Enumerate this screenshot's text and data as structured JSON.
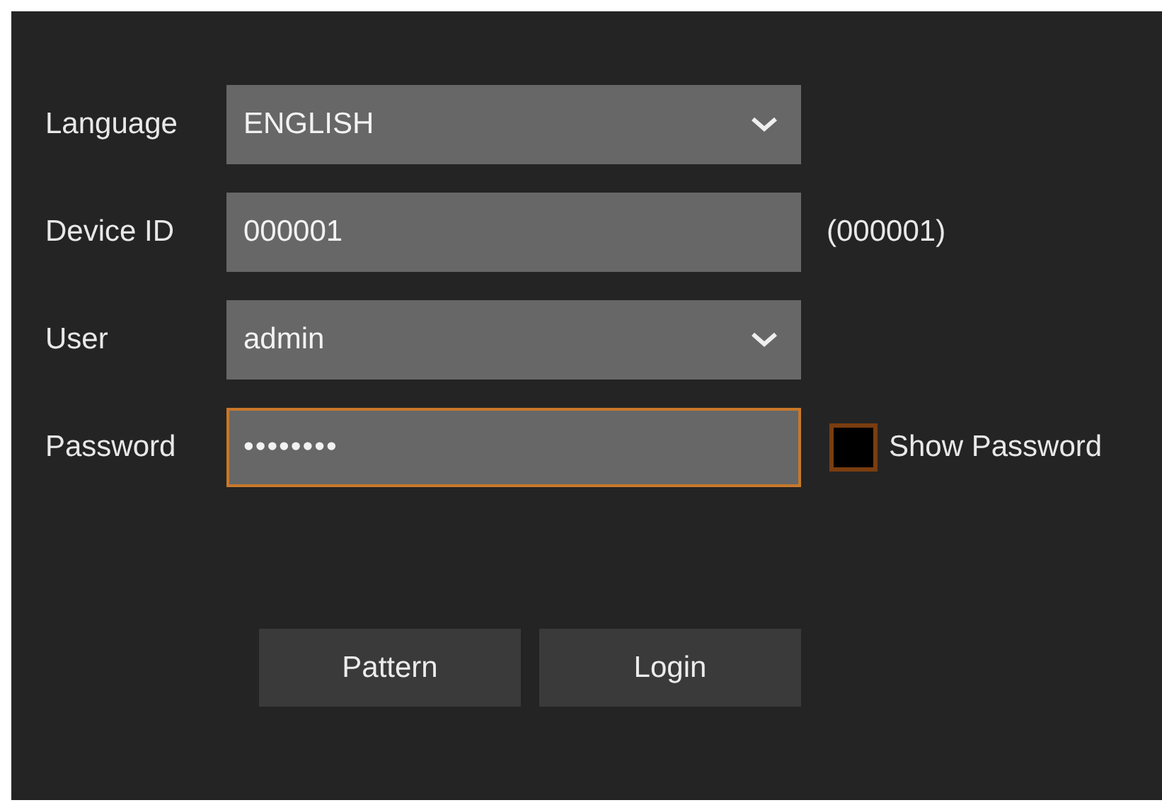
{
  "fields": [
    {
      "label": "Language",
      "kind": "select",
      "value": "ENGLISH",
      "focused": false
    },
    {
      "label": "Device ID",
      "kind": "text",
      "value": "000001",
      "focused": false,
      "note": "(000001)"
    },
    {
      "label": "User",
      "kind": "select",
      "value": "admin",
      "focused": false
    },
    {
      "label": "Password",
      "kind": "password",
      "value": "••••••••",
      "focused": true,
      "show_password": {
        "label": "Show Password",
        "checked": false
      }
    }
  ],
  "buttons": [
    "Pattern",
    "Login"
  ]
}
